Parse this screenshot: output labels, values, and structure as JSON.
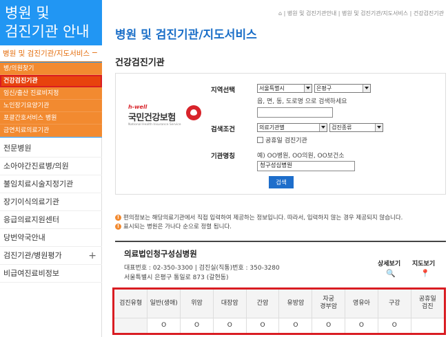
{
  "sidebar": {
    "title_line1": "병원 및",
    "title_line2": "검진기관 안내",
    "current": "병원 및 검진기관/지도서비스",
    "current_icon": "minus",
    "sub_items": [
      {
        "label": "병/의원찾기"
      },
      {
        "label": "건강검진기관"
      },
      {
        "label": "임신/출산 진료비지정"
      },
      {
        "label": "노인장기요양기관"
      },
      {
        "label": "포괄간호서비스 병원"
      },
      {
        "label": "금연치료의료기관"
      }
    ],
    "menu_items": [
      {
        "label": "전문병원"
      },
      {
        "label": "소아야간진료병/의원"
      },
      {
        "label": "불임치료시술지정기관"
      },
      {
        "label": "장기이식의료기관"
      },
      {
        "label": "응급의료지원센터"
      },
      {
        "label": "당번약국안내"
      },
      {
        "label": "검진기관/병원평가",
        "expand": "+"
      },
      {
        "label": "비급여진료비정보"
      }
    ]
  },
  "breadcrumb": "| 병원 및 검진기관안내 | 병원 및 검진기관/지도서비스 | 건강검진기관",
  "page_title": "병원 및 검진기관/지도서비스",
  "section_title": "건강검진기관",
  "search": {
    "logo": {
      "tag": "h-well",
      "name": "국민건강보험",
      "eng": "National Health Insurance Service"
    },
    "region_label": "지역선택",
    "region_city": "서울특별시",
    "region_district": "은평구",
    "address_hint": "읍, 면, 동, 도로명 으로 검색하세요",
    "address_value": "",
    "condition_label": "검색조건",
    "condition_type": "의료기관별",
    "condition_kind": "검진종류",
    "holiday_checkbox": "공휴일 검진기관",
    "name_label": "기관명칭",
    "name_hint": "예) OO병원, OO의원, OO보건소",
    "name_value": "청구성심병원",
    "search_button": "검색"
  },
  "notices": [
    "편의정보는 해당의료기관에서 직접 입력하여 제공하는 정보입니다. 따라서, 입력하지 않는 경우 제공되지 않습니다.",
    "표시되는 병원은 가나다 순으로 정렬 됩니다."
  ],
  "hospital": {
    "name": "의료법인청구성심병원",
    "phone": "대표번호 : 02-350-3300 | 검진실(직통)번호 : 350-3280",
    "address": "서울특별시 은평구 통일로 873 (갈현동)",
    "detail_label": "상세보기",
    "map_label": "지도보기"
  },
  "table": {
    "headers": [
      "검진유형",
      "일반(생애)",
      "위암",
      "대장암",
      "간암",
      "유방암",
      "자궁\n경부암",
      "영유아",
      "구강",
      "공휴일\n검진"
    ],
    "values": [
      "",
      "O",
      "O",
      "O",
      "O",
      "O",
      "O",
      "O",
      "O",
      ""
    ]
  },
  "colors": {
    "sidebar_blue": "#2196f3",
    "orange": "#f28a30",
    "active": "#e8430d",
    "highlight_red": "#d91c22",
    "title_blue": "#1b6fc8",
    "button_blue": "#1e6ecb"
  }
}
